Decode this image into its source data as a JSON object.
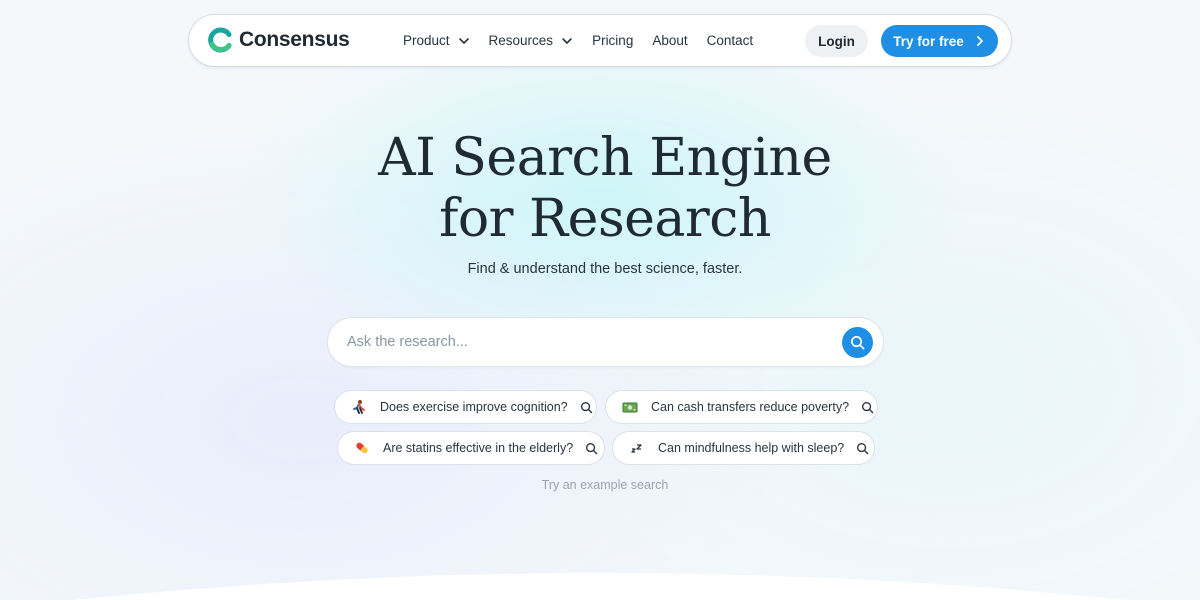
{
  "nav": {
    "brand": "Consensus",
    "items": [
      {
        "label": "Product",
        "dropdown": true
      },
      {
        "label": "Resources",
        "dropdown": true
      },
      {
        "label": "Pricing",
        "dropdown": false
      },
      {
        "label": "About",
        "dropdown": false
      },
      {
        "label": "Contact",
        "dropdown": false
      }
    ],
    "login_label": "Login",
    "cta_label": "Try for free"
  },
  "hero": {
    "title_line1": "AI Search Engine",
    "title_line2": "for Research",
    "subtitle": "Find & understand the best science, faster."
  },
  "search": {
    "placeholder": "Ask the research...",
    "value": ""
  },
  "examples": {
    "items": [
      {
        "label": "Does exercise improve cognition?",
        "icon": "running-person-icon"
      },
      {
        "label": "Can cash transfers reduce poverty?",
        "icon": "money-bill-icon"
      },
      {
        "label": "Are statins effective in the elderly?",
        "icon": "pill-icon"
      },
      {
        "label": "Can mindfulness help with sleep?",
        "icon": "sleep-icon"
      }
    ],
    "hint": "Try an example search"
  },
  "colors": {
    "accent": "#1f8fe6",
    "brand_green": "#3ec38a",
    "brand_teal": "#1aa6a0",
    "text": "#1f2a33"
  }
}
